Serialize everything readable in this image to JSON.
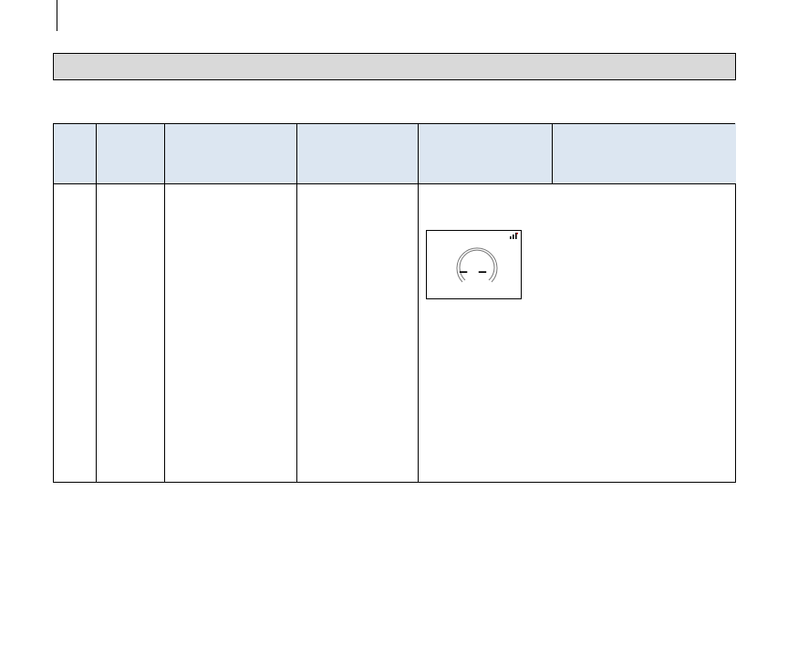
{
  "section_title": "",
  "table": {
    "headers": [
      "",
      "",
      "",
      "",
      "",
      ""
    ],
    "row": {
      "cells": [
        "",
        "",
        "",
        ""
      ],
      "display": {
        "reading": "– –",
        "signal_icon": "signal-bars-icon",
        "signal_color": "#c00000"
      }
    }
  }
}
